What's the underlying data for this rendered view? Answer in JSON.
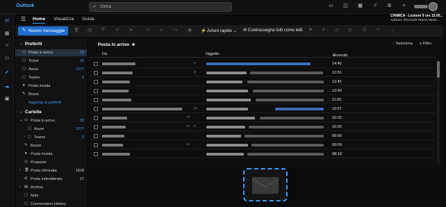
{
  "app": {
    "title": "Outlook"
  },
  "search": {
    "placeholder": "Cerca"
  },
  "ribbon": {
    "tabs": [
      "Home",
      "Visualizza",
      "Guida"
    ],
    "active_tab": "Home",
    "new_message": "Nuovo messaggio",
    "quick_steps": "Azioni rapide",
    "mark_all_read": "Contrassegna tutti come letti"
  },
  "notification": {
    "title": "CHIMICA - Lezione 9 ore 15.00...",
    "subtitle": "Adesso, Microsoft Teams Meeti..."
  },
  "folder_pane": {
    "favorites_label": "Preferiti",
    "favorites": [
      {
        "label": "Posta in arrivo",
        "count": "30",
        "selected": true
      },
      {
        "label": "Ticket",
        "count": "32"
      },
      {
        "label": "Azure",
        "count": "1377"
      },
      {
        "label": "Teams",
        "count": "2"
      },
      {
        "label": "Posta inviata",
        "count": ""
      },
      {
        "label": "Bozze",
        "count": ""
      }
    ],
    "add_favorite": "Aggiungi ai preferiti",
    "folders_label": "Cartelle",
    "folders": [
      {
        "label": "Posta in arrivo",
        "count": "30",
        "level": 0,
        "chevron": true
      },
      {
        "label": "Azure",
        "count": "1377",
        "level": 1
      },
      {
        "label": "Teams",
        "count": "2",
        "level": 1,
        "chevron": true
      },
      {
        "label": "Bozze",
        "count": "",
        "level": 0
      },
      {
        "label": "Posta inviata",
        "count": "",
        "level": 0
      },
      {
        "label": "Posposto",
        "count": "",
        "level": 0
      },
      {
        "label": "Posta eliminata",
        "count": "1828",
        "level": 0,
        "grey": true
      },
      {
        "label": "Posta indesiderata",
        "count": "27",
        "level": 0,
        "grey": true
      },
      {
        "label": "Archive",
        "count": "",
        "level": 0,
        "chevron": true
      },
      {
        "label": "Note",
        "count": "",
        "level": 0
      },
      {
        "label": "Conversation History",
        "count": "",
        "level": 0
      }
    ]
  },
  "message_list": {
    "title": "Posta in arrivo",
    "select_label": "Seleziona",
    "filter_label": "Filtro",
    "columns": {
      "from": "Da",
      "subject": "Oggetto",
      "received": "Ricevuto"
    },
    "rows": [
      {
        "time": "14:45"
      },
      {
        "time": "12:51"
      },
      {
        "time": "12:45"
      },
      {
        "time": "12:40"
      },
      {
        "time": "11:00"
      },
      {
        "time": "10:57"
      },
      {
        "time": "10:35"
      },
      {
        "time": "10:25"
      },
      {
        "time": "09:59"
      },
      {
        "time": "09:09"
      },
      {
        "time": "08:19"
      }
    ]
  }
}
